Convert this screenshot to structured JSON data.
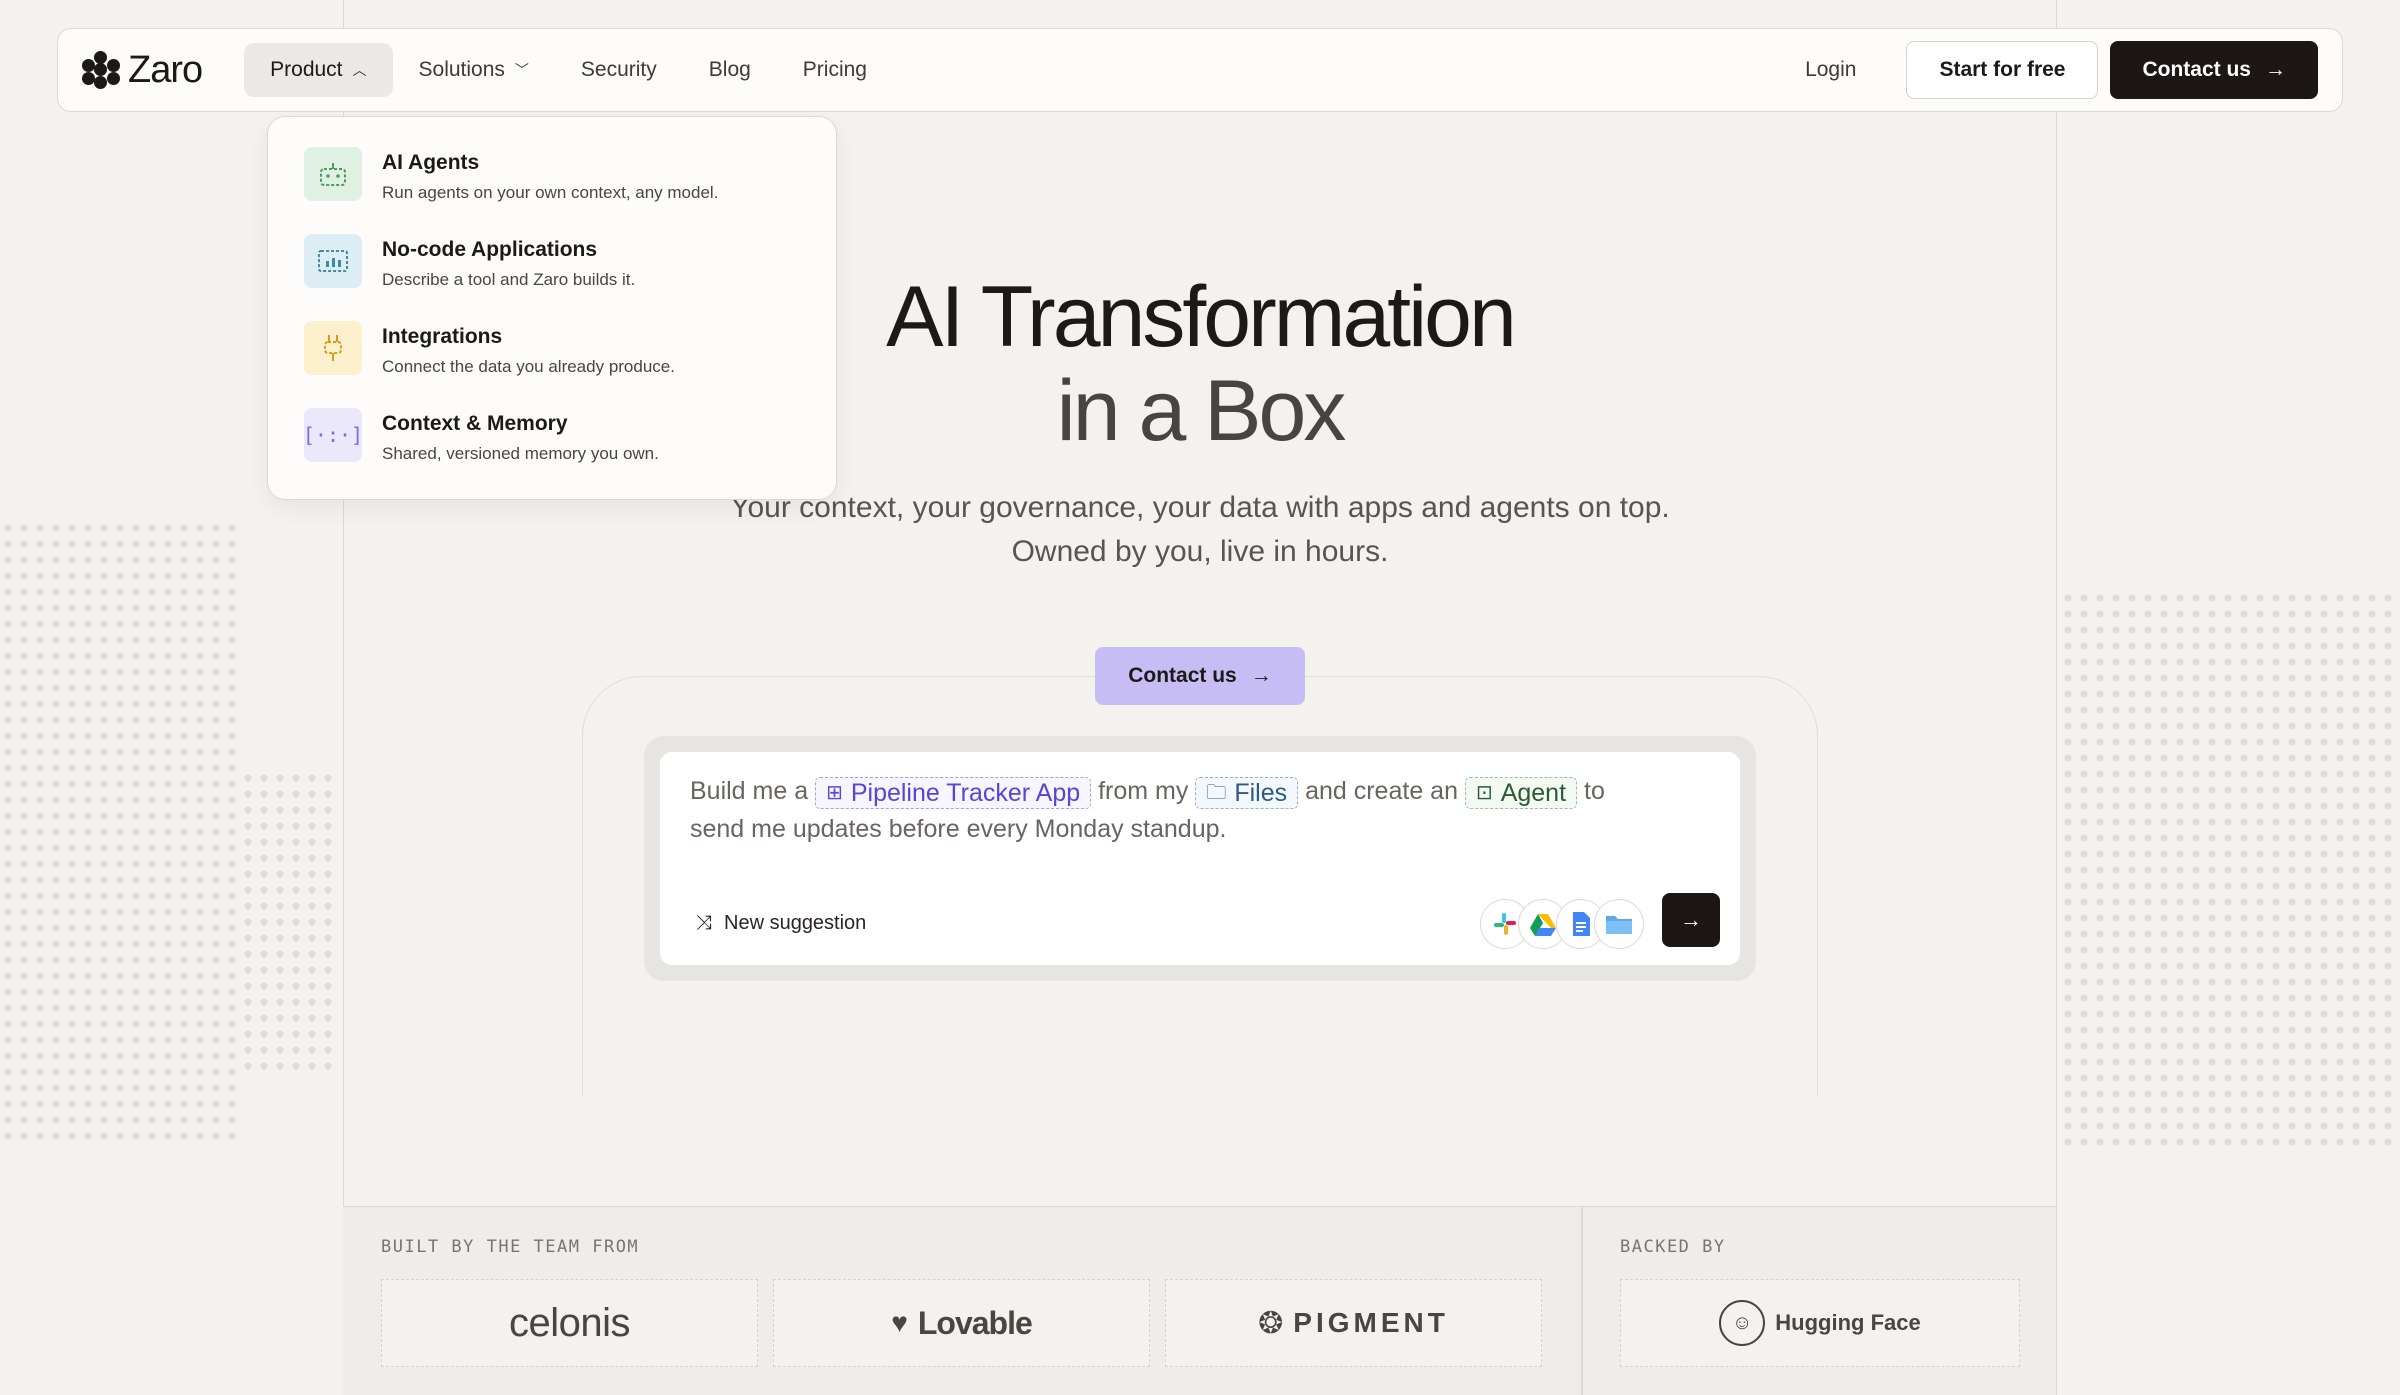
{
  "brand": {
    "name": "Zaro"
  },
  "nav": {
    "items": [
      {
        "label": "Product",
        "active": true
      },
      {
        "label": "Solutions"
      },
      {
        "label": "Security"
      },
      {
        "label": "Blog"
      },
      {
        "label": "Pricing"
      }
    ],
    "login": "Login",
    "start": "Start for free",
    "contact": "Contact us"
  },
  "dropdown": {
    "items": [
      {
        "title": "AI Agents",
        "desc": "Run agents on your own context, any model.",
        "icon": "robot-icon",
        "color": "#dff1e3"
      },
      {
        "title": "No-code Applications",
        "desc": "Describe a tool and Zaro builds it.",
        "icon": "app-chart-icon",
        "color": "#dcedf3"
      },
      {
        "title": "Integrations",
        "desc": "Connect the data you already produce.",
        "icon": "plug-icon",
        "color": "#fdf0cc"
      },
      {
        "title": "Context & Memory",
        "desc": "Shared, versioned memory you own.",
        "icon": "brackets-icon",
        "color": "#ebe8fb"
      }
    ]
  },
  "hero": {
    "title_line1": "AI Transformation",
    "title_line2": "in a Box",
    "sub_line1": "Your context, your governance, your data with apps and agents on top.",
    "sub_line2": "Owned by you, live in hours.",
    "cta": "Contact us"
  },
  "prompt": {
    "t1": "Build me a",
    "chip1": "Pipeline Tracker App",
    "t2": "from my",
    "chip2": "Files",
    "t3": "and create an",
    "chip3": "Agent",
    "t4": "to",
    "t5": "send me updates before every Monday standup.",
    "new_suggestion": "New suggestion",
    "integrations": [
      "slack-icon",
      "google-drive-icon",
      "google-docs-icon",
      "folder-icon"
    ]
  },
  "bottom": {
    "built_label": "BUILT BY THE TEAM FROM",
    "backed_label": "BACKED BY",
    "logos": [
      "celonis",
      "Lovable",
      "PIGMENT"
    ],
    "backer": "Hugging Face"
  }
}
